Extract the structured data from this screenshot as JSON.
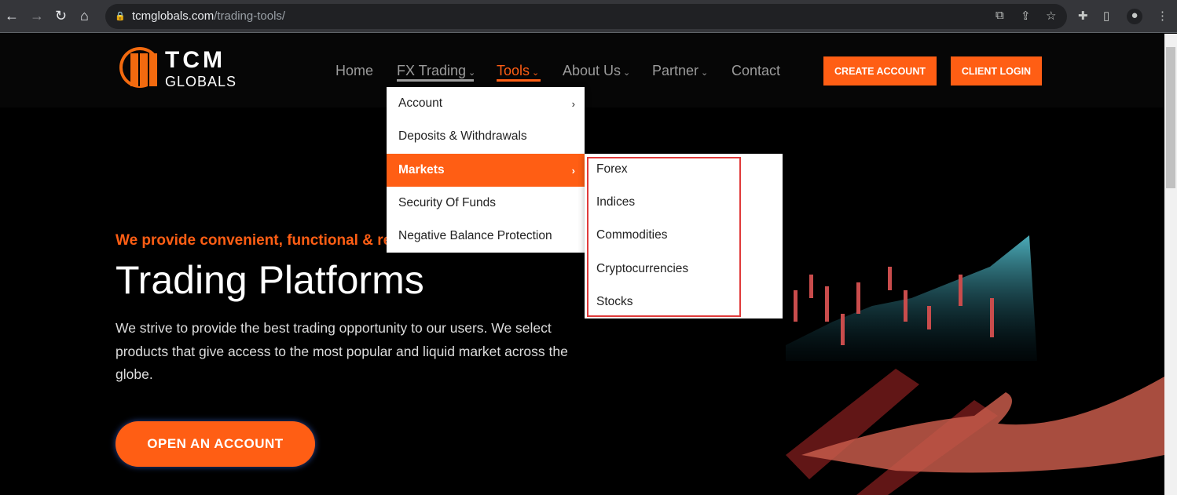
{
  "browser": {
    "url_domain": "tcmglobals.com",
    "url_path": "/trading-tools/",
    "icons": [
      "back-icon",
      "forward-icon",
      "reload-icon",
      "home-icon",
      "lock-icon",
      "translate-icon",
      "share-icon",
      "star-icon",
      "extensions-icon",
      "sidepanel-icon",
      "profile-icon",
      "more-icon"
    ]
  },
  "logo": {
    "line1": "TCM",
    "line2": "GLOBALS"
  },
  "nav": {
    "items": [
      {
        "label": "Home"
      },
      {
        "label": "FX Trading"
      },
      {
        "label": "Tools"
      },
      {
        "label": "About Us"
      },
      {
        "label": "Partner"
      },
      {
        "label": "Contact"
      }
    ],
    "create_account": "CREATE ACCOUNT",
    "client_login": "CLIENT LOGIN"
  },
  "tools_menu": {
    "items": [
      {
        "label": "Account"
      },
      {
        "label": "Deposits & Withdrawals"
      },
      {
        "label": "Markets"
      },
      {
        "label": "Security Of Funds"
      },
      {
        "label": "Negative Balance Protection"
      }
    ],
    "selected": "Markets"
  },
  "markets_menu": {
    "items": [
      {
        "label": "Forex"
      },
      {
        "label": "Indices"
      },
      {
        "label": "Commodities"
      },
      {
        "label": "Cryptocurrencies"
      },
      {
        "label": "Stocks"
      }
    ]
  },
  "hero": {
    "tagline": "We provide convenient, functional & re",
    "title": "Trading Platforms",
    "description": "We strive to provide the best trading opportunity to our users. We select products that give access to the most popular and liquid market across the globe.",
    "cta": "OPEN AN ACCOUNT"
  },
  "colors": {
    "accent": "#ff5e14",
    "highlight_box": "#e03a3a"
  }
}
